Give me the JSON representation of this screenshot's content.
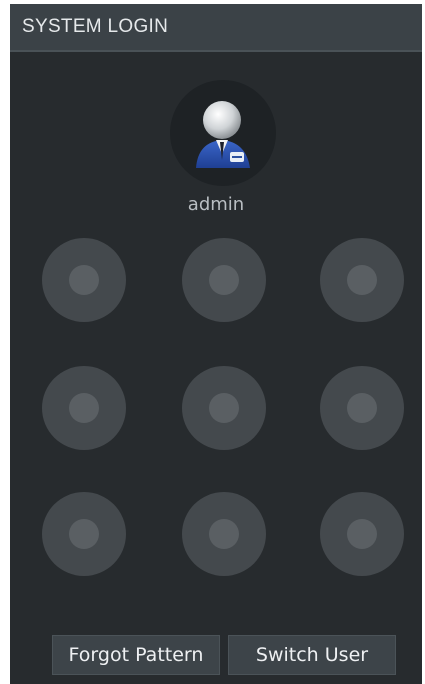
{
  "header": {
    "title": "SYSTEM LOGIN"
  },
  "user": {
    "name": "admin",
    "avatar_icon": "user-avatar-icon"
  },
  "pattern": {
    "nodes": [
      "1",
      "2",
      "3",
      "4",
      "5",
      "6",
      "7",
      "8",
      "9"
    ]
  },
  "buttons": {
    "forgot_pattern": "Forgot Pattern",
    "switch_user": "Switch User"
  },
  "colors": {
    "panel_bg": "#272b2e",
    "titlebar_bg": "#3b4247",
    "node_outer": "#44494d",
    "node_inner": "#5a5f63",
    "button_bg": "#3d4449"
  }
}
